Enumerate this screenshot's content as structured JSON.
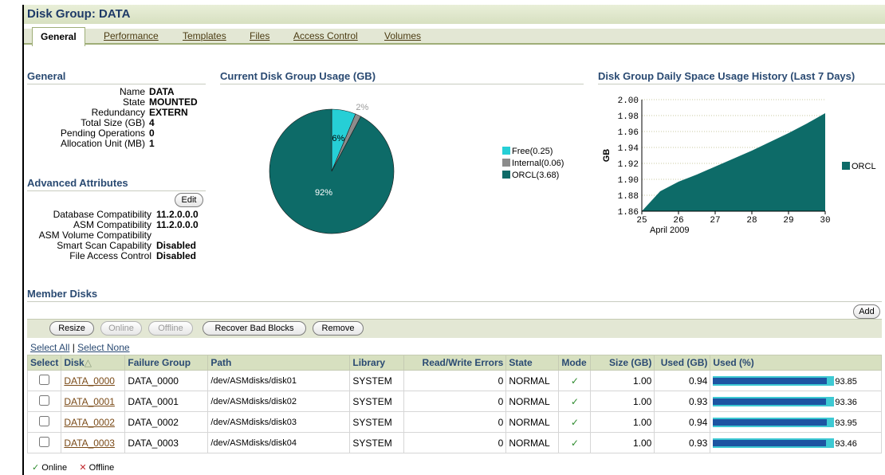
{
  "page": {
    "title": "Disk Group: DATA"
  },
  "tabs": [
    {
      "label": "General"
    },
    {
      "label": "Performance"
    },
    {
      "label": "Templates"
    },
    {
      "label": "Files"
    },
    {
      "label": "Access Control"
    },
    {
      "label": "Volumes"
    }
  ],
  "general": {
    "heading": "General",
    "rows": [
      {
        "label": "Name",
        "value": "DATA"
      },
      {
        "label": "State",
        "value": "MOUNTED"
      },
      {
        "label": "Redundancy",
        "value": "EXTERN"
      },
      {
        "label": "Total Size (GB)",
        "value": "4"
      },
      {
        "label": "Pending Operations",
        "value": "0"
      },
      {
        "label": "Allocation Unit (MB)",
        "value": "1"
      }
    ]
  },
  "advanced": {
    "heading": "Advanced Attributes",
    "edit_label": "Edit",
    "rows": [
      {
        "label": "Database Compatibility",
        "value": "11.2.0.0.0"
      },
      {
        "label": "ASM Compatibility",
        "value": "11.2.0.0.0"
      },
      {
        "label": "ASM Volume Compatibility",
        "value": ""
      },
      {
        "label": "Smart Scan Capability",
        "value": "Disabled"
      },
      {
        "label": "File Access Control",
        "value": "Disabled"
      }
    ]
  },
  "colors": {
    "free": "#26cfd6",
    "internal": "#8c8c8c",
    "orcl": "#0d6b68",
    "header_bg": "#d7e0c0",
    "title_text": "#1e3a67"
  },
  "chart_data": [
    {
      "type": "pie",
      "title": "Current Disk Group Usage (GB)",
      "slices": [
        {
          "name": "Free(0.25)",
          "value": 0.25,
          "label": "6%",
          "color": "#26cfd6"
        },
        {
          "name": "Internal(0.06)",
          "value": 0.06,
          "label": "2%",
          "color": "#8c8c8c"
        },
        {
          "name": "ORCL(3.68)",
          "value": 3.68,
          "label": "92%",
          "color": "#0d6b68"
        }
      ]
    },
    {
      "type": "area",
      "title": "Disk Group Daily Space Usage History (Last 7 Days)",
      "ylabel": "GB",
      "xlabel": "April 2009",
      "ylim": [
        1.86,
        2.0
      ],
      "xlim": [
        25,
        30
      ],
      "yticks": [
        "2.00",
        "1.98",
        "1.96",
        "1.94",
        "1.92",
        "1.90",
        "1.88",
        "1.86"
      ],
      "xticks": [
        "25",
        "26",
        "27",
        "28",
        "29",
        "30"
      ],
      "series": [
        {
          "name": "ORCL",
          "color": "#0d6b68",
          "x": [
            25,
            25.5,
            26,
            26.5,
            27,
            27.5,
            28,
            28.5,
            29,
            29.5,
            30
          ],
          "values": [
            1.86,
            1.885,
            1.897,
            1.906,
            1.916,
            1.926,
            1.936,
            1.947,
            1.958,
            1.97,
            1.983
          ]
        }
      ]
    }
  ],
  "member_disks": {
    "heading": "Member Disks",
    "add_label": "Add",
    "buttons": [
      {
        "label": "Resize",
        "enabled": true
      },
      {
        "label": "Online",
        "enabled": false
      },
      {
        "label": "Offline",
        "enabled": false
      },
      {
        "label": "Recover Bad Blocks",
        "enabled": true
      },
      {
        "label": "Remove",
        "enabled": true
      }
    ],
    "select_all": "Select All",
    "select_none": "Select None",
    "columns": [
      "Select",
      "Disk",
      "Failure Group",
      "Path",
      "Library",
      "Read/Write Errors",
      "State",
      "Mode",
      "Size (GB)",
      "Used (GB)",
      "Used (%)"
    ],
    "rows": [
      {
        "disk": "DATA_0000",
        "failure_group": "DATA_0000",
        "path": "/dev/ASMdisks/disk01",
        "library": "SYSTEM",
        "errors": "0",
        "state": "NORMAL",
        "size": "1.00",
        "used": "0.94",
        "used_pct": "93.85"
      },
      {
        "disk": "DATA_0001",
        "failure_group": "DATA_0001",
        "path": "/dev/ASMdisks/disk02",
        "library": "SYSTEM",
        "errors": "0",
        "state": "NORMAL",
        "size": "1.00",
        "used": "0.93",
        "used_pct": "93.36"
      },
      {
        "disk": "DATA_0002",
        "failure_group": "DATA_0002",
        "path": "/dev/ASMdisks/disk03",
        "library": "SYSTEM",
        "errors": "0",
        "state": "NORMAL",
        "size": "1.00",
        "used": "0.94",
        "used_pct": "93.95"
      },
      {
        "disk": "DATA_0003",
        "failure_group": "DATA_0003",
        "path": "/dev/ASMdisks/disk04",
        "library": "SYSTEM",
        "errors": "0",
        "state": "NORMAL",
        "size": "1.00",
        "used": "0.93",
        "used_pct": "93.46"
      }
    ],
    "legend": {
      "online": "Online",
      "offline": "Offline"
    }
  }
}
